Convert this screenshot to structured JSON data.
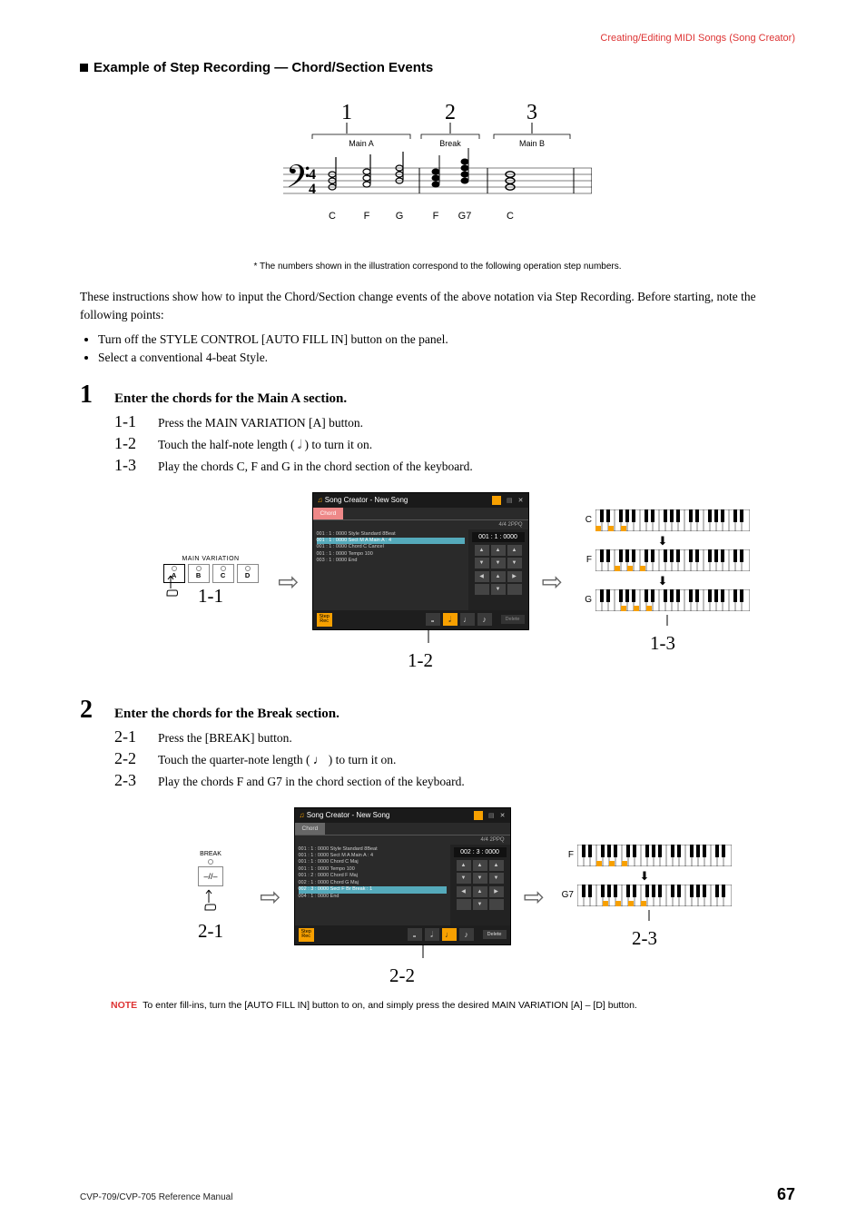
{
  "header": {
    "breadcrumb": "Creating/Editing MIDI Songs (Song Creator)"
  },
  "section": {
    "title": "Example of Step Recording — Chord/Section Events"
  },
  "notation": {
    "numbers": [
      "1",
      "2",
      "3"
    ],
    "segments": [
      "Main A",
      "Break",
      "Main B"
    ],
    "chords": [
      "C",
      "F",
      "G",
      "F",
      "G7",
      "C"
    ]
  },
  "footnote": "* The numbers shown in the illustration correspond to the following operation step numbers.",
  "intro": "These instructions show how to input the Chord/Section change events of the above notation via Step Recording. Before starting, note the following points:",
  "bullets": [
    "Turn off the STYLE CONTROL [AUTO FILL IN] button on the panel.",
    "Select a conventional 4-beat Style."
  ],
  "step1": {
    "num": "1",
    "title": "Enter the chords for the Main A section.",
    "subs": [
      {
        "n": "1-1",
        "t": "Press the MAIN VARIATION [A] button."
      },
      {
        "n": "1-2",
        "t": "Touch the half-note length ( 𝅗𝅥 ) to turn it on."
      },
      {
        "n": "1-3",
        "t": "Play the chords C, F and G in the chord section of the keyboard."
      }
    ],
    "panel": {
      "title": "MAIN VARIATION",
      "buttons": [
        "A",
        "B",
        "C",
        "D"
      ],
      "caption": "1-1"
    },
    "screenshot": {
      "title": "Song Creator - New Song",
      "tab": "Chord",
      "meta": "4/4    2PPQ",
      "rows": [
        "001 : 1 : 0000   Style   Standard 8Beat",
        "001 : 1 : 0000   Sect    M     A     Main A   : 4",
        "001 : 1 : 0000   Chord   C     Cancel",
        "001 : 1 : 0000   Tempo   100",
        "003 : 1 : 0000   End"
      ],
      "counter": "001 :    1 : 0000",
      "step_rec": "Step\nRec",
      "selected_note": "half",
      "delete": "Delete",
      "caption": "1-2"
    },
    "keyboards": {
      "labels": [
        "C",
        "F",
        "G"
      ],
      "caption": "1-3"
    }
  },
  "step2": {
    "num": "2",
    "title": "Enter the chords for the Break section.",
    "subs": [
      {
        "n": "2-1",
        "t": "Press the [BREAK] button."
      },
      {
        "n": "2-2",
        "t": "Touch the quarter-note length ( ♩ ) to turn it on."
      },
      {
        "n": "2-3",
        "t": "Play the chords F and G7 in the chord section of the keyboard."
      }
    ],
    "panel": {
      "title": "BREAK",
      "glyph": "⁠–//–",
      "caption": "2-1"
    },
    "screenshot": {
      "title": "Song Creator - New Song",
      "tab": "Chord",
      "meta": "4/4    2PPQ",
      "rows": [
        "001 : 1 : 0000   Style   Standard 8Beat",
        "001 : 1 : 0000   Sect    M     A     Main A   : 4",
        "001 : 1 : 0000   Chord   C     Maj",
        "001 : 1 : 0000   Tempo   100",
        "001 : 2 : 0000   Chord   F     Maj",
        "002 : 1 : 0000   Chord   G     Maj",
        "002 : 3 : 0000   Sect    F     Br    Break   : 1",
        "004 : 1 : 0000   End"
      ],
      "counter": "002 :    3 : 0000",
      "step_rec": "Step\nRec",
      "selected_note": "quarter",
      "delete": "Delete",
      "caption": "2-2"
    },
    "keyboards": {
      "labels": [
        "F",
        "G7"
      ],
      "caption": "2-3"
    }
  },
  "note": {
    "label": "NOTE",
    "text": "To enter fill-ins, turn the [AUTO FILL IN] button to on, and simply press the desired MAIN VARIATION [A] – [D] button."
  },
  "footer": {
    "left": "CVP-709/CVP-705 Reference Manual",
    "right": "67"
  }
}
